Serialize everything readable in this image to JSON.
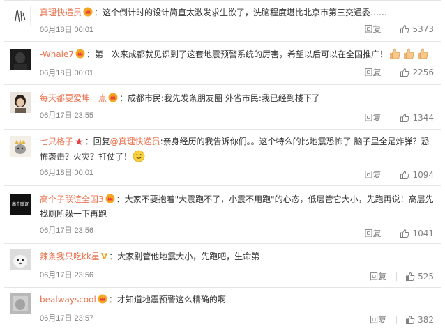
{
  "comments": [
    {
      "username": "真理快递员",
      "badge": "crown",
      "text": "：这个倒计时的设计简直太激发求生欲了，洗脑程度堪比北京市第三交通委……",
      "time": "06月18日 00:01",
      "reply_label": "回复",
      "likes": "5373"
    },
    {
      "username": "-Whale7",
      "badge": "crown",
      "text": "：第一次来成都就见识到了这套地震预警系统的厉害，希望以后可以在全国推广！",
      "emojis": [
        "thumbs-up",
        "thumbs-up",
        "thumbs-up"
      ],
      "time": "06月18日 00:01",
      "reply_label": "回复",
      "likes": "2256"
    },
    {
      "username": "每天都要爱坤一点",
      "badge": "crown",
      "text": "：成都市民:我先发条朋友圈 外省市民:我已经到楼下了",
      "time": "06月17日 23:55",
      "reply_label": "回复",
      "likes": "1344"
    },
    {
      "username": "七只格子",
      "badge": "star",
      "text_prefix": "：回复",
      "mention": "@真理快递员",
      "text_line1": ":亲身经历的我告诉你们。。这个特么的比地震恐怖了 脑子里全是炸弹？恐",
      "text_line2": "怖袭击？火灾？打仗了！",
      "emojis": [
        "smile"
      ],
      "time": "06月18日 00:01",
      "reply_label": "回复",
      "likes": "1094"
    },
    {
      "username": "高个子联谊全国3",
      "badge": "crown",
      "avatar_text": "高个联谊",
      "text_line1": "：大家不要抱着\"大震跑不了，小震不用跑\"的心态，低层管它大小，先跑再说！高层先",
      "text_line2": "找厕所躲一下再跑",
      "time": "06月17日 23:56",
      "reply_label": "回复",
      "likes": "1041"
    },
    {
      "username": "辣条我只吃kk星",
      "badge": "v",
      "badge_text": "V",
      "text": "：大家别管他地震大小，先跑吧，生命第一",
      "time": "06月17日 23:56",
      "reply_label": "回复",
      "likes": "525"
    },
    {
      "username": "bealwayscool",
      "badge": "crown",
      "text": "：才知道地震预警这么精确的啊",
      "time": "06月17日 23:57",
      "reply_label": "回复",
      "likes": "382"
    }
  ],
  "colors": {
    "username": "#eb7350",
    "meta": "#808080",
    "text": "#333333",
    "crown": "#f5a623",
    "star": "#e83d3d"
  },
  "icons": {
    "like": "thumbs-up-icon",
    "badge_crown": "crown-icon",
    "badge_star": "star-icon"
  }
}
